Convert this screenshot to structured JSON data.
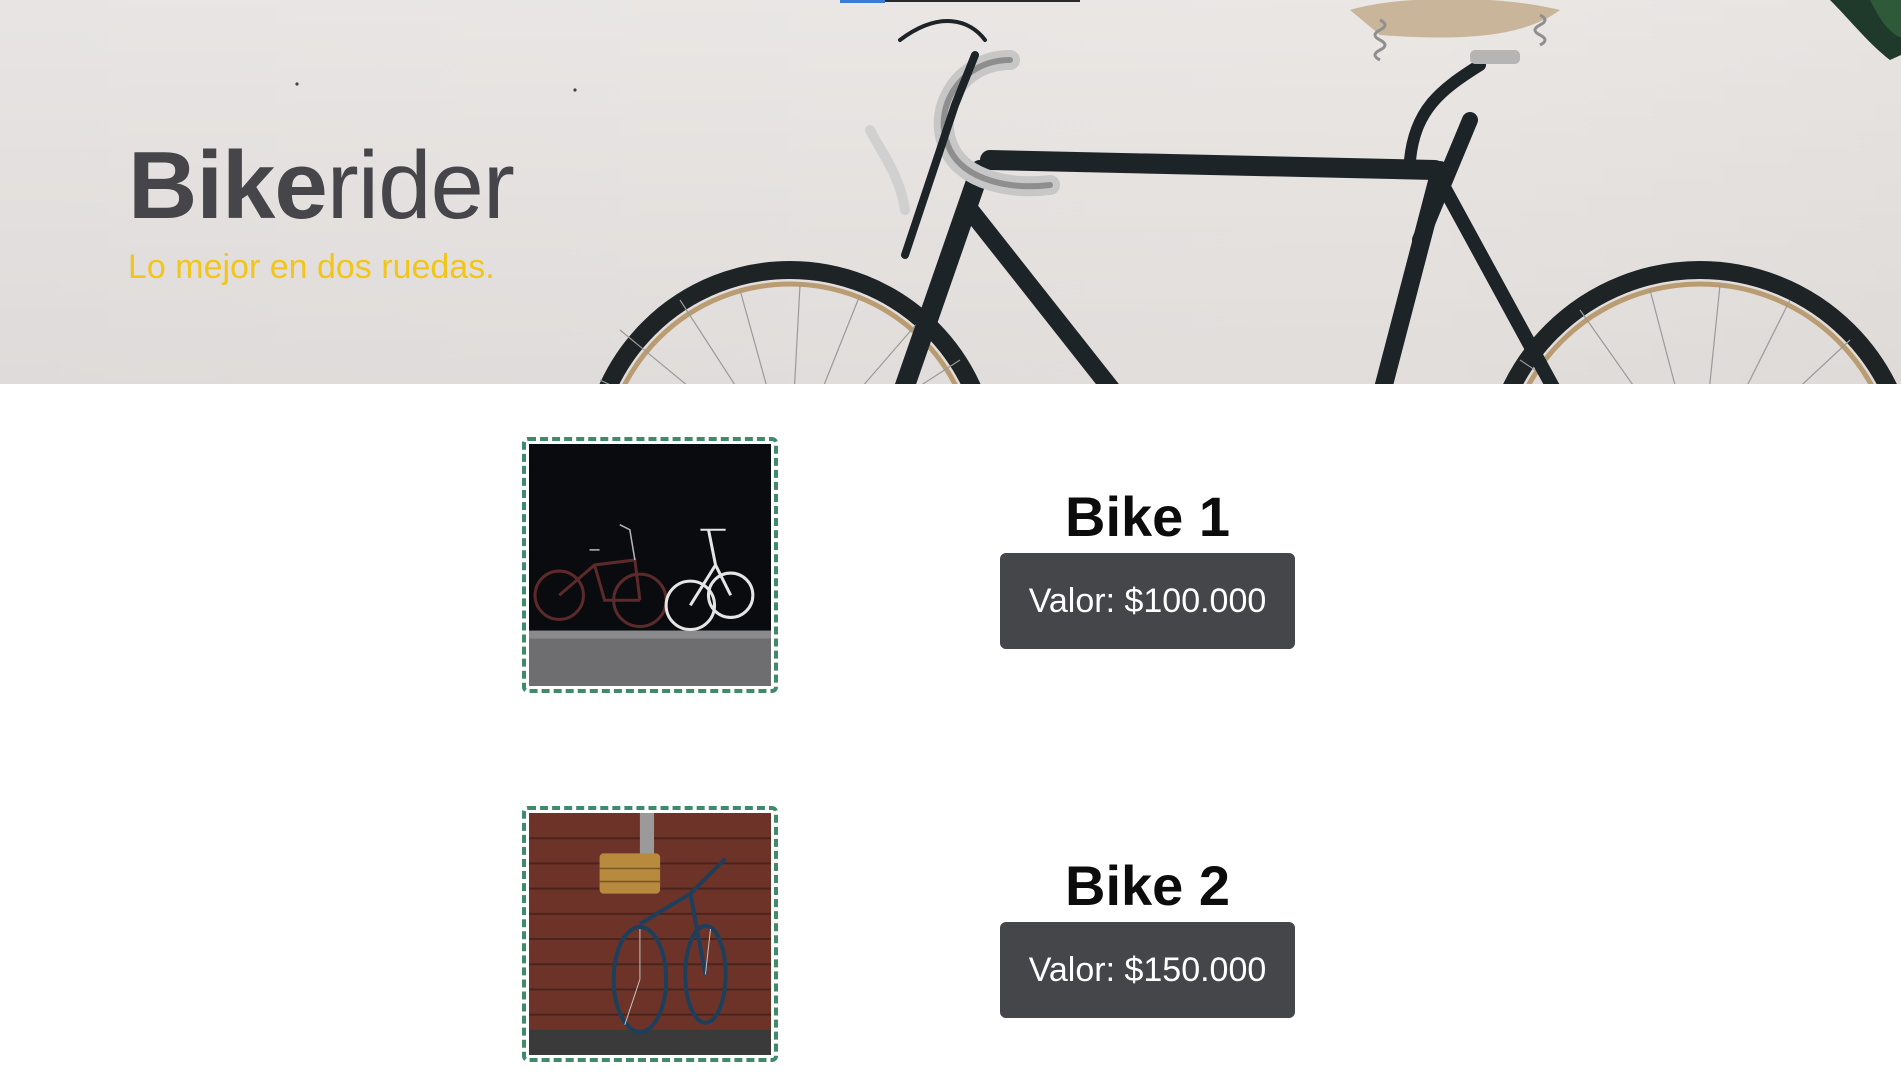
{
  "brand": {
    "title_bold": "Bike",
    "title_light": "rider",
    "tagline": "Lo mejor en dos ruedas."
  },
  "colors": {
    "title": "#46464a",
    "tagline": "#f2c618",
    "price_bg": "#45464a",
    "thumb_border": "#3f8a6a"
  },
  "products": [
    {
      "name": "Bike 1",
      "price": "Valor: $100.000"
    },
    {
      "name": "Bike 2",
      "price": "Valor: $150.000"
    }
  ]
}
